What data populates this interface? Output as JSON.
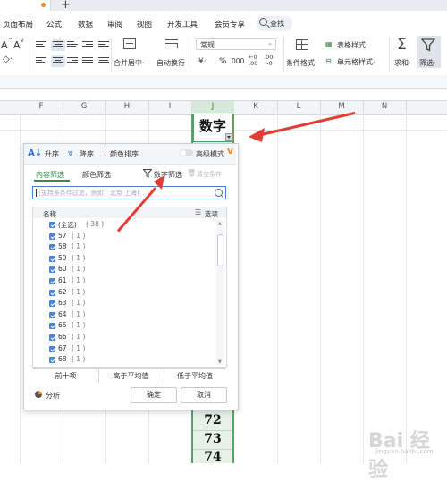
{
  "menu": {
    "items": [
      "页面布局",
      "公式",
      "数据",
      "审阅",
      "视图",
      "开发工具",
      "会员专享"
    ],
    "search_label": "查找"
  },
  "toolbar": {
    "font_a_plus": "A",
    "font_a_minus": "A",
    "number_format": "常规",
    "merge_label": "合并居中·",
    "wrap_label": "自动换行",
    "yen": "¥·",
    "percent": "%",
    "thousands": "000",
    "dec_inc": "←0 .00",
    "dec_dec": ".00 →0",
    "cond_format": "条件格式·",
    "table_style": "表格样式·",
    "cell_style": "单元格样式·",
    "sum_label": "求和·",
    "filter_label": "筛选·"
  },
  "columns": [
    "F",
    "G",
    "H",
    "I",
    "J",
    "K",
    "L",
    "M",
    "N"
  ],
  "cell_header_text": "数字",
  "cell_values": [
    "72",
    "73",
    "74"
  ],
  "filter_panel": {
    "sort_asc": "升序",
    "sort_desc": "降序",
    "color_sort": "颜色排序",
    "advanced_mode": "高级模式",
    "tab_content": "内容筛选",
    "tab_color": "颜色筛选",
    "number_filter": "数字筛选",
    "clear_filter": "清空条件",
    "search_placeholder": "(支持多条件过滤，例如：北京 上海)",
    "list_header_name": "名称",
    "list_header_options": "选项",
    "items": [
      {
        "label": "(全选)",
        "count": "( 38 )"
      },
      {
        "label": "57",
        "count": "( 1 )"
      },
      {
        "label": "58",
        "count": "( 1 )"
      },
      {
        "label": "59",
        "count": "( 1 )"
      },
      {
        "label": "60",
        "count": "( 1 )"
      },
      {
        "label": "61",
        "count": "( 1 )"
      },
      {
        "label": "62",
        "count": "( 1 )"
      },
      {
        "label": "63",
        "count": "( 1 )"
      },
      {
        "label": "64",
        "count": "( 1 )"
      },
      {
        "label": "65",
        "count": "( 1 )"
      },
      {
        "label": "66",
        "count": "( 1 )"
      },
      {
        "label": "67",
        "count": "( 1 )"
      },
      {
        "label": "68",
        "count": "( 1 )"
      }
    ],
    "btn_top10": "前十项",
    "btn_above_avg": "高于平均值",
    "btn_below_avg": "低于平均值",
    "analysis": "分析",
    "ok": "确定",
    "cancel": "取消"
  },
  "watermark": {
    "main": "Bai 经验",
    "sub": "jingyan.baidu.com"
  },
  "colors": {
    "accent_green": "#2f8f45",
    "arrow_red": "#e53b35",
    "selection_blue": "#4a84d6"
  }
}
